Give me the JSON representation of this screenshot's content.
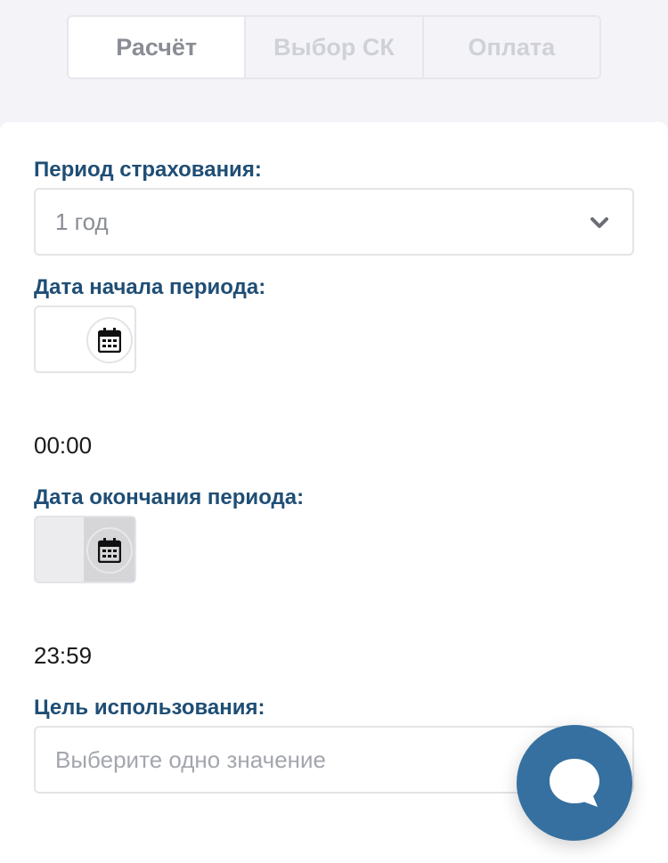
{
  "tabs": [
    {
      "label": "Расчёт",
      "active": true
    },
    {
      "label": "Выбор СК",
      "active": false
    },
    {
      "label": "Оплата",
      "active": false
    }
  ],
  "form": {
    "period_label": "Период страхования:",
    "period_value": "1 год",
    "start_label": "Дата начала периода:",
    "start_time": "00:00",
    "end_label": "Дата окончания периода:",
    "end_time": "23:59",
    "purpose_label": "Цель использования:",
    "purpose_placeholder": "Выберите одно значение"
  },
  "icons": {
    "dropdown": "chevron-down-icon",
    "calendar": "calendar-icon",
    "chat": "chat-icon"
  },
  "colors": {
    "label": "#1f4e75",
    "chat_button": "#3570a0"
  }
}
